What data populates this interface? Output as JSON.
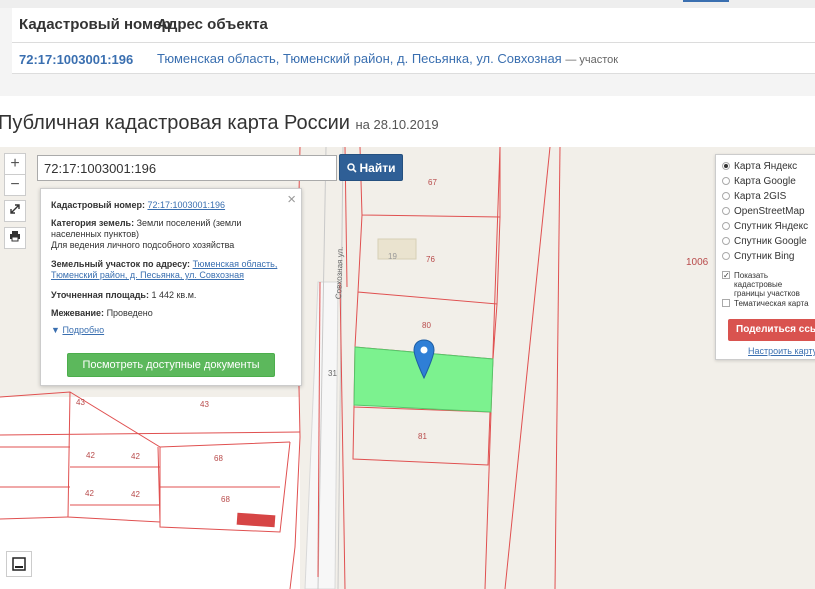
{
  "results": {
    "headers": [
      "Кадастровый номер",
      "Адрес объекта"
    ],
    "rows": [
      {
        "number": "72:17:1003001:196",
        "address": "Тюменская область, Тюменский район, д. Песьянка, ул. Совхозная",
        "type": "— участок"
      }
    ]
  },
  "page": {
    "title": "Публичная кадастровая карта России",
    "date": "на 28.10.2019"
  },
  "map": {
    "zoom_in": "+",
    "zoom_out": "−",
    "search_value": "72:17:1003001:196",
    "find_label": "Найти",
    "street_label": "Совхозная ул.",
    "parcel_labels": [
      {
        "text": "67"
      },
      {
        "text": "76"
      },
      {
        "text": "19"
      },
      {
        "text": "80"
      },
      {
        "text": "81"
      },
      {
        "text": "43"
      },
      {
        "text": "43"
      },
      {
        "text": "42"
      },
      {
        "text": "42"
      },
      {
        "text": "42"
      },
      {
        "text": "42"
      },
      {
        "text": "68"
      },
      {
        "text": "68"
      },
      {
        "text": "31"
      },
      {
        "text": "1006"
      }
    ],
    "selected_fill": "#7cf28f",
    "boundary_color": "#e05050"
  },
  "popup": {
    "close": "×",
    "cadastral_label": "Кадастровый номер:",
    "cadastral_value": "72:17:1003001:196",
    "category_label": "Категория земель:",
    "category_value": "Земли поселений (земли населенных пунктов)",
    "usage": "Для ведения личного подсобного хозяйства",
    "address_label": "Земельный участок по адресу:",
    "address_value": "Тюменская область, Тюменский район, д. Песьянка, ул. Совхозная",
    "area_label": "Уточненная площадь:",
    "area_value": "1 442 кв.м.",
    "survey_label": "Межевание:",
    "survey_value": "Проведено",
    "more": "Подробно",
    "docs_button": "Посмотреть доступные документы"
  },
  "layers": {
    "options": [
      {
        "label": "Карта Яндекс",
        "selected": true
      },
      {
        "label": "Карта Google",
        "selected": false
      },
      {
        "label": "Карта 2GIS",
        "selected": false
      },
      {
        "label": "OpenStreetMap",
        "selected": false
      },
      {
        "label": "Спутник Яндекс",
        "selected": false
      },
      {
        "label": "Спутник Google",
        "selected": false
      },
      {
        "label": "Спутник Bing",
        "selected": false
      }
    ],
    "show_boundaries": "Показать кадастровые границы участков",
    "thematic": "Тематическая карта",
    "share": "Поделиться ссылкой",
    "tune": "Настроить карту"
  }
}
